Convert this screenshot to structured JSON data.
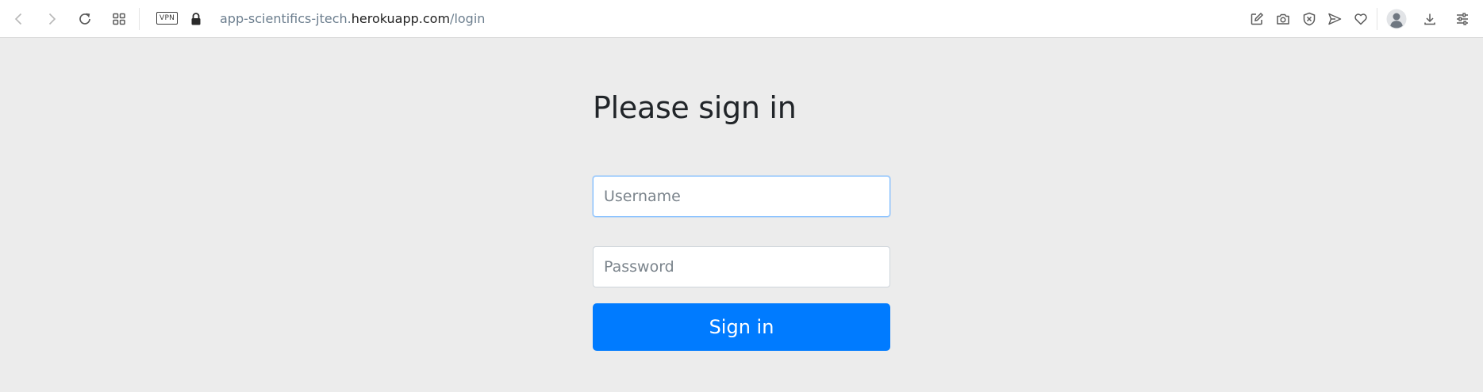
{
  "browser": {
    "vpn_label": "VPN",
    "url_prefix": "app-scientifics-jtech.",
    "url_host": "herokuapp.com",
    "url_path": "/login",
    "icons": [
      "back-icon",
      "forward-icon",
      "reload-icon",
      "tabs-grid-icon",
      "lock-icon",
      "edit-icon",
      "camera-icon",
      "block-icon",
      "send-icon",
      "heart-icon",
      "profile-icon",
      "download-icon",
      "settings-sliders-icon"
    ]
  },
  "signin": {
    "heading": "Please sign in",
    "username_placeholder": "Username",
    "username_value": "",
    "password_placeholder": "Password",
    "password_value": "",
    "button_label": "Sign in"
  },
  "colors": {
    "page_background": "#ececec",
    "primary": "#007bff",
    "focus_border": "#80bdff",
    "heading": "#212529"
  }
}
